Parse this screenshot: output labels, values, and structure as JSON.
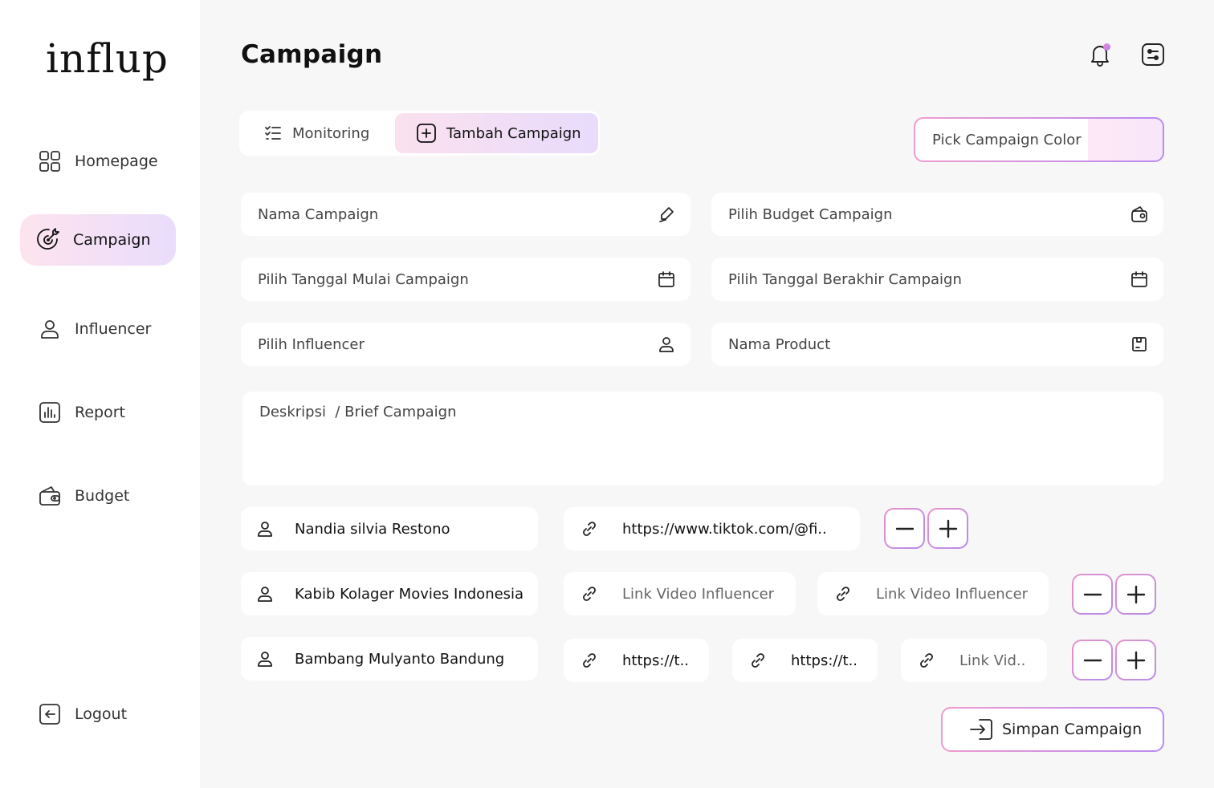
{
  "app": {
    "logo": "influp"
  },
  "sidebar": {
    "items": [
      {
        "label": "Homepage",
        "icon": "grid-icon"
      },
      {
        "label": "Campaign",
        "icon": "target-icon",
        "active": true
      },
      {
        "label": "Influencer",
        "icon": "user-icon"
      },
      {
        "label": "Report",
        "icon": "chart-icon"
      },
      {
        "label": "Budget",
        "icon": "wallet-icon"
      }
    ],
    "logout": "Logout"
  },
  "header": {
    "title": "Campaign"
  },
  "tabs": [
    {
      "label": "Monitoring"
    },
    {
      "label": "Tambah Campaign",
      "active": true
    }
  ],
  "color_picker": {
    "label": "Pick Campaign Color",
    "swatch_color": "#fce8f7"
  },
  "form": {
    "nama_campaign": "Nama Campaign",
    "budget": "Pilih Budget Campaign",
    "tanggal_mulai": "Pilih Tanggal Mulai Campaign",
    "tanggal_berakhir": "Pilih Tanggal Berakhir Campaign",
    "influencer": "Pilih Influencer",
    "nama_product": "Nama Product",
    "deskripsi": "Deskripsi  / Brief Campaign"
  },
  "influencer_rows": [
    {
      "name": "Nandia silvia Restono",
      "links": [
        "https://www.tiktok.com/@fi.."
      ]
    },
    {
      "name": "Kabib Kolager Movies Indonesia",
      "links": [
        "Link Video Influencer",
        "Link Video Influencer"
      ]
    },
    {
      "name": "Bambang Mulyanto Bandung",
      "links": [
        "https://t..",
        "https://t..",
        "Link Vid.."
      ]
    }
  ],
  "save_button": "Simpan Campaign",
  "colors": {
    "accent_pink": "#ef9ccf",
    "accent_purple": "#b88af2",
    "active_bg_start": "#fde4ee",
    "active_bg_end": "#eadcfd"
  }
}
